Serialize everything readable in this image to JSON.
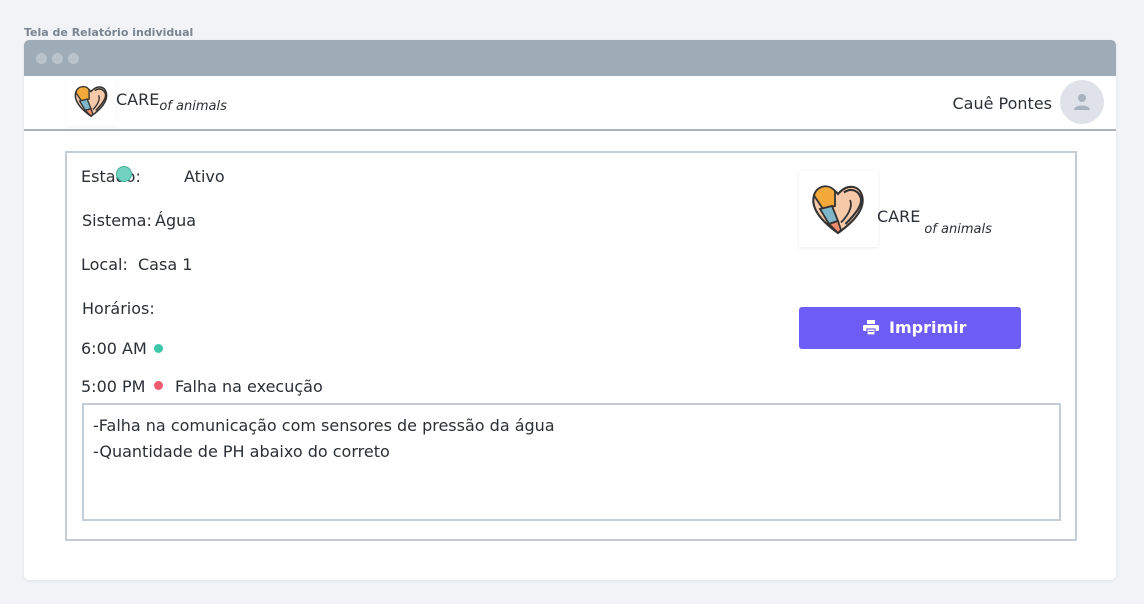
{
  "frame": {
    "label": "Tela de Relatório individual"
  },
  "navbar": {
    "brand": "CARE",
    "brand_sub": "of animals",
    "user_name": "Cauê Pontes"
  },
  "report": {
    "state_label": "Estado:",
    "state_value": "Ativo",
    "system_label": "Sistema:",
    "system_value": "Água",
    "local_label": "Local:",
    "local_value": "Casa 1",
    "schedules_label": "Horários:",
    "schedules": [
      {
        "time": "6:00 AM",
        "status_color": "#3cc7a8",
        "message": ""
      },
      {
        "time": "5:00 PM",
        "status_color": "#ef5a6f",
        "message": "Falha na  execução"
      }
    ],
    "notes": [
      "-Falha na comunicação com sensores de pressão da água",
      "-Quantidade de PH abaixo do correto"
    ]
  },
  "card_brand": {
    "brand": "CARE",
    "brand_sub": "of animals"
  },
  "actions": {
    "print_label": "Imprimir"
  },
  "colors": {
    "accent": "#6d5cf6",
    "active": "#71d3bf",
    "ok": "#3cc7a8",
    "error": "#ef5a6f"
  },
  "icons": {
    "logo": "heart-hands-icon",
    "avatar": "user-icon",
    "print": "printer-icon"
  }
}
